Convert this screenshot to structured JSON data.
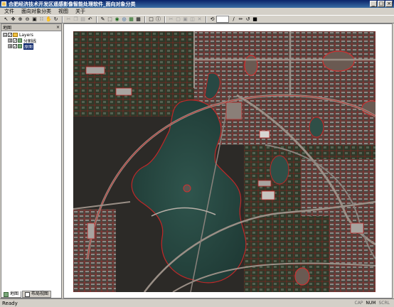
{
  "window": {
    "title": "合肥经济技术开发区遥感影像智能处理软件_面向对象分类",
    "minimize": "_",
    "maximize": "□",
    "close": "×"
  },
  "menu": [
    "文件",
    "面向对象分类",
    "视图",
    "关于"
  ],
  "toolbar": {
    "select_value": "",
    "icons": [
      "pointer-icon",
      "pan-icon",
      "zoom-in-icon",
      "zoom-out-icon",
      "full-extent-icon",
      "fixed-zoom-icon",
      "hand-icon",
      "refresh-icon",
      "cut-icon",
      "copy-icon",
      "paste-icon",
      "undo-icon",
      "edit-icon",
      "select-icon",
      "identify-icon",
      "globe-icon",
      "layers-icon",
      "table-icon",
      "info-icon",
      "measure-icon",
      "pen-icon",
      "check-icon",
      "save-icon"
    ]
  },
  "sidebar": {
    "title": "地图",
    "close": "×",
    "tree": [
      {
        "label": "Layers",
        "level": 0,
        "expander": "⊟",
        "checked": "✓",
        "icon": "folder"
      },
      {
        "label": "分割线",
        "level": 1,
        "expander": "⊞",
        "checked": "✓",
        "icon": "layer"
      },
      {
        "label": "原图",
        "level": 1,
        "expander": "⊞",
        "checked": "✓",
        "icon": "layer"
      }
    ],
    "tabs": [
      {
        "label": "地图"
      },
      {
        "label": "布局视图"
      }
    ]
  },
  "status": {
    "text": "Ready",
    "keys": [
      "CAP",
      "NUM",
      "SCRL"
    ]
  },
  "colors": {
    "title_bar": "#0a246a",
    "segment_lines": "#d02020",
    "lake": "#2b4a44"
  }
}
